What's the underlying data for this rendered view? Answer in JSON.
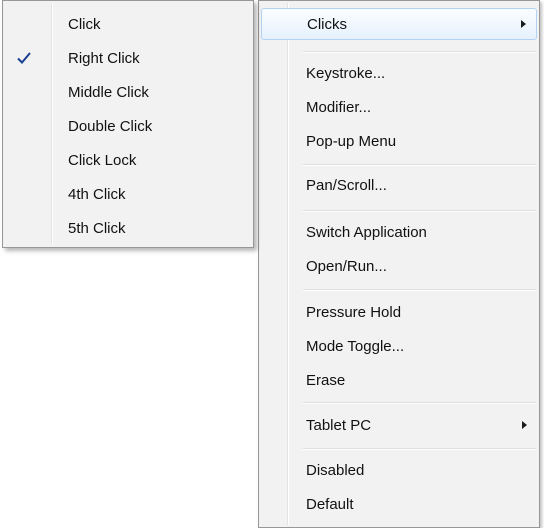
{
  "main_menu": {
    "items": [
      {
        "label": "Clicks",
        "submenu": true,
        "highlighted": true
      },
      {
        "label": "Keystroke..."
      },
      {
        "label": "Modifier..."
      },
      {
        "label": "Pop-up Menu"
      },
      {
        "label": "Pan/Scroll..."
      },
      {
        "label": "Switch Application"
      },
      {
        "label": "Open/Run..."
      },
      {
        "label": "Pressure Hold"
      },
      {
        "label": "Mode Toggle..."
      },
      {
        "label": "Erase"
      },
      {
        "label": "Tablet PC",
        "submenu": true
      },
      {
        "label": "Disabled"
      },
      {
        "label": "Default"
      }
    ]
  },
  "clicks_submenu": {
    "items": [
      {
        "label": "Click"
      },
      {
        "label": "Right Click",
        "checked": true
      },
      {
        "label": "Middle Click"
      },
      {
        "label": "Double Click"
      },
      {
        "label": "Click Lock"
      },
      {
        "label": "4th Click"
      },
      {
        "label": "5th Click"
      }
    ]
  },
  "colors": {
    "menu_background": "#f2f2f2",
    "menu_border": "#979797",
    "highlight_border": "#b2d2f3",
    "check_color": "#1a3f8f"
  }
}
